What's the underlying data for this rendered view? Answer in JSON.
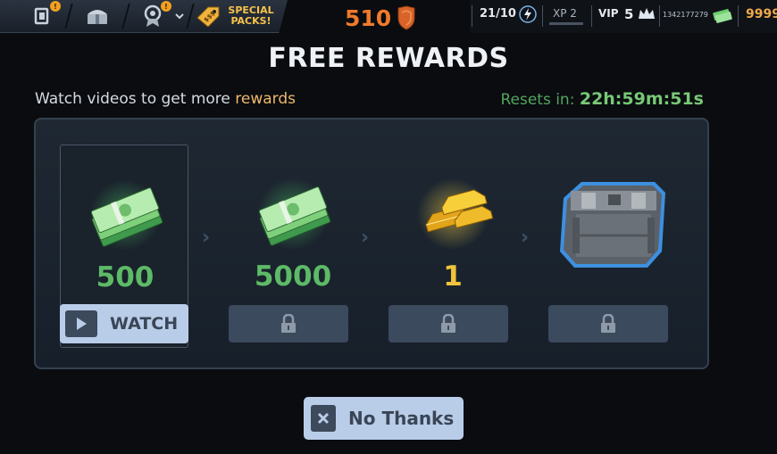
{
  "topbar": {
    "badges": {
      "inventory": "!",
      "quests": "!"
    },
    "special_packs": {
      "line1": "SPECIAL",
      "line2": "PACKS!",
      "tag": "$$$"
    },
    "trophies": "510",
    "energy": "21/10",
    "xp_label": "XP 2",
    "vip_label": "VIP",
    "vip_level": "5",
    "cash_small": "1342177279",
    "gold_partial": "9999"
  },
  "title": "FREE REWARDS",
  "subtitle": {
    "prefix": "Watch videos to get more ",
    "highlight": "rewards"
  },
  "resets": {
    "label": "Resets in: ",
    "time": "22h:59m:51s"
  },
  "rewards": [
    {
      "type": "cash",
      "amount": "500",
      "button": "WATCH",
      "locked": false
    },
    {
      "type": "cash",
      "amount": "5000",
      "locked": true
    },
    {
      "type": "gold",
      "amount": "1",
      "locked": true
    },
    {
      "type": "crate",
      "amount": "",
      "locked": true
    }
  ],
  "chevron": "›",
  "no_thanks": "No Thanks",
  "icons": [
    "inventory-icon",
    "chest-icon",
    "quest-medal-icon",
    "chevron-down-icon",
    "price-tag-icon",
    "trophy-shield-icon",
    "energy-bolt-icon",
    "crown-icon",
    "cash-icon",
    "cash-stack-icon",
    "gold-bars-icon",
    "crate-icon",
    "play-icon",
    "lock-icon",
    "close-icon"
  ],
  "colors": {
    "accent_green": "#5dba67",
    "gold": "#efc43a",
    "button_bg": "#b9cde9",
    "trophy_orange": "#ef7a2c"
  }
}
